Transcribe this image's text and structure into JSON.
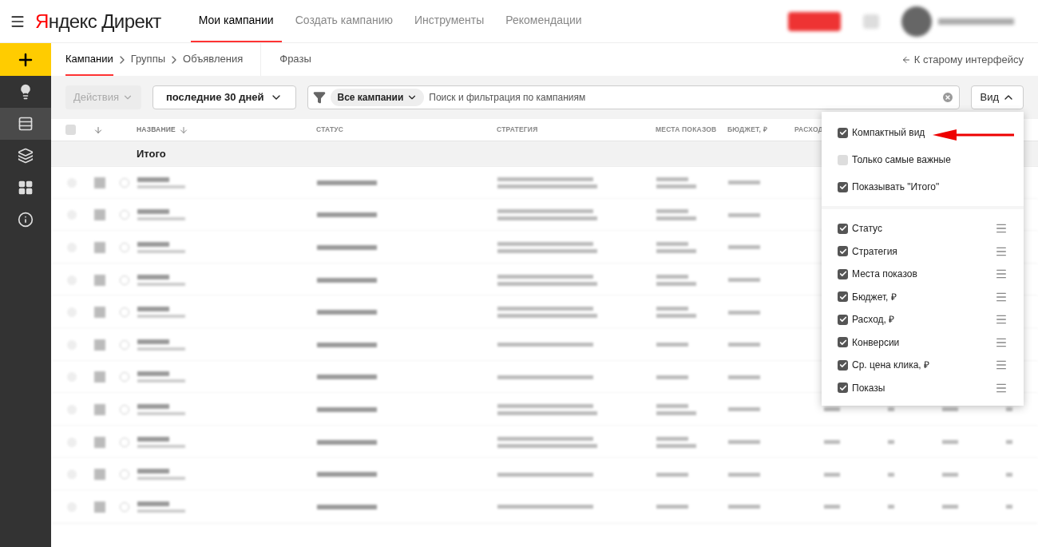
{
  "header": {
    "logo": {
      "brand": "Яндекс",
      "product": "Директ"
    },
    "nav": [
      {
        "label": "Мои кампании",
        "selected": true
      },
      {
        "label": "Создать кампанию",
        "selected": false
      },
      {
        "label": "Инструменты",
        "selected": false
      },
      {
        "label": "Рекомендации",
        "selected": false
      }
    ]
  },
  "sidebar": {
    "items": [
      {
        "kind": "add",
        "selected": false
      },
      {
        "kind": "ideas",
        "selected": false
      },
      {
        "kind": "campaigns",
        "selected": true
      },
      {
        "kind": "stack",
        "selected": false
      },
      {
        "kind": "grid",
        "selected": false
      },
      {
        "kind": "info",
        "selected": false
      }
    ]
  },
  "subnav": {
    "breadcrumbs": [
      {
        "label": "Кампании",
        "selected": true
      },
      {
        "label": "Группы",
        "selected": false
      },
      {
        "label": "Объявления",
        "selected": false
      }
    ],
    "phrases": {
      "label": "Фразы",
      "selected": false
    },
    "back_link": "К старому интерфейсу"
  },
  "toolbar": {
    "actions": {
      "label": "Действия",
      "disabled": true
    },
    "period": "последние 30 дней",
    "filter_chip": "Все кампании",
    "search": {
      "placeholder": "Поиск и фильтрация по кампаниям"
    },
    "view_button": {
      "label": "Вид",
      "expanded": true
    }
  },
  "table": {
    "select_all": {
      "checked": false
    },
    "columns": [
      {
        "label": "НАЗВАНИЕ",
        "sorted": true
      },
      {
        "label": "СТАТУС",
        "sorted": false
      },
      {
        "label": "СТРАТЕГИЯ",
        "sorted": false
      },
      {
        "label": "МЕСТА ПОКАЗОВ",
        "sorted": false
      },
      {
        "label": "БЮДЖЕТ, ₽",
        "sorted": false
      },
      {
        "label": "РАСХОД",
        "sorted": false
      }
    ],
    "total_label": "Итого"
  },
  "view_menu": {
    "options": [
      {
        "label": "Компактный вид",
        "checked": true
      },
      {
        "label": "Только самые важные",
        "checked": false
      },
      {
        "label": "Показывать \"Итого\"",
        "checked": true
      }
    ],
    "columns": [
      {
        "label": "Статус",
        "checked": true
      },
      {
        "label": "Стратегия",
        "checked": true
      },
      {
        "label": "Места показов",
        "checked": true
      },
      {
        "label": "Бюджет, ₽",
        "checked": true
      },
      {
        "label": "Расход, ₽",
        "checked": true
      },
      {
        "label": "Конверсии",
        "checked": true
      },
      {
        "label": "Ср. цена клика, ₽",
        "checked": true
      },
      {
        "label": "Показы",
        "checked": true
      }
    ]
  }
}
